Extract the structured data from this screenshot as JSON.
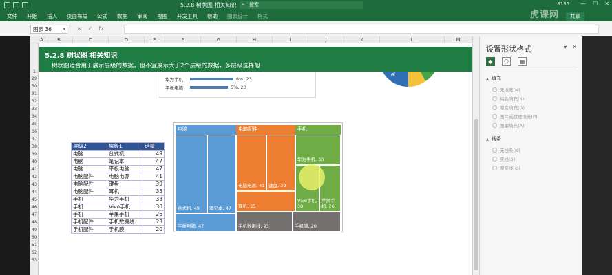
{
  "titlebar": {
    "title": "5.2.8 树状图 相关知识",
    "search": "搜索",
    "number": "8135",
    "share": "共享"
  },
  "ribbon": {
    "tabs": [
      "文件",
      "开始",
      "插入",
      "页面布局",
      "公式",
      "数据",
      "审阅",
      "视图",
      "开发工具",
      "帮助",
      "图表设计",
      "格式"
    ]
  },
  "formula_bar": {
    "name_box": "图表 36",
    "cancel": "×",
    "confirm": "✓",
    "fx": "fx",
    "value": ""
  },
  "columns": [
    "A",
    "B",
    "C",
    "D",
    "E",
    "F",
    "G",
    "H",
    "I",
    "J",
    "K",
    "L",
    "M"
  ],
  "rows": [
    "1",
    "29",
    "30",
    "31",
    "32",
    "33",
    "34",
    "35",
    "36",
    "37",
    "38",
    "39",
    "40",
    "41",
    "42",
    "43",
    "44",
    "45",
    "46",
    "47",
    "48",
    "49",
    "50",
    "51",
    "52",
    "53"
  ],
  "banner": {
    "title": "5.2.8 树状图 相关知识",
    "subtitle": "树状图适合用于展示层级的数据，但不宜展示大于2个层级的数据，多层级选择旭"
  },
  "barchart": {
    "rows": [
      {
        "label": "华为手机",
        "value_label": "6%, 23",
        "value": 23
      },
      {
        "label": "平板电脑",
        "value_label": "5%, 20",
        "value": 20
      }
    ]
  },
  "pie_labels": [
    "电脑配件"
  ],
  "table": {
    "headers": [
      "层级2",
      "层级1",
      "销量"
    ],
    "rows": [
      [
        "电脑",
        "台式机",
        "49"
      ],
      [
        "电脑",
        "笔记本",
        "47"
      ],
      [
        "电脑",
        "平板电脑",
        "47"
      ],
      [
        "电脑配件",
        "电脑电源",
        "41"
      ],
      [
        "电脑配件",
        "键盘",
        "39"
      ],
      [
        "电脑配件",
        "耳机",
        "35"
      ],
      [
        "手机",
        "华为手机",
        "33"
      ],
      [
        "手机",
        "Vivo手机",
        "30"
      ],
      [
        "手机",
        "苹果手机",
        "26"
      ],
      [
        "手机配件",
        "手机数据线",
        "23"
      ],
      [
        "手机配件",
        "手机膜",
        "20"
      ]
    ]
  },
  "treemap": {
    "groups": [
      {
        "name": "电脑",
        "color": "#5b9bd5"
      },
      {
        "name": "电脑配件",
        "color": "#ed7d31"
      },
      {
        "name": "手机",
        "color": "#70ad47"
      }
    ],
    "tiles": {
      "desktop": "台式机, 49",
      "laptop": "笔记本, 47",
      "tablet": "平板电脑, 47",
      "psu": "电脑电源, 41",
      "keyboard": "键盘, 39",
      "earphone": "耳机, 35",
      "huawei": "华为手机, 33",
      "vivo": "Vivo手机, 30",
      "apple": "苹果手机, 26",
      "cable": "手机数据线, 23",
      "film": "手机膜, 20"
    },
    "grey_color": "#767171"
  },
  "format_pane": {
    "title": "设置形状格式",
    "fill_section": "填充",
    "fill_options": [
      "无填充(N)",
      "纯色填充(S)",
      "渐变填充(G)",
      "图片或纹理填充(P)",
      "图案填充(A)"
    ],
    "line_section": "线条",
    "line_options": [
      "无线条(N)",
      "实线(S)",
      "渐变线(G)"
    ]
  },
  "watermark": "虎课网"
}
